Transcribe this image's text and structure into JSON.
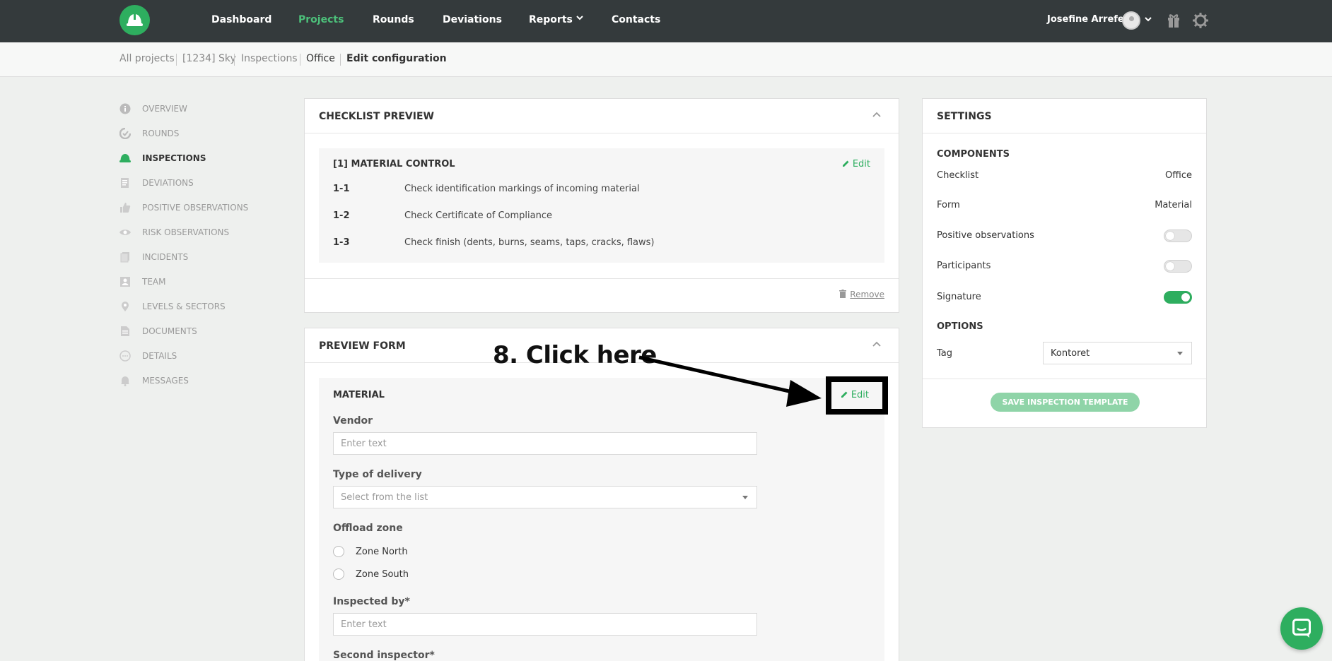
{
  "nav": {
    "items": [
      "Dashboard",
      "Projects",
      "Rounds",
      "Deviations",
      "Reports",
      "Contacts"
    ],
    "active": "Projects",
    "user_name": "Josefine Arrefelt"
  },
  "breadcrumb": {
    "items": [
      "All projects",
      "[1234] Sky",
      "Inspections",
      "Office",
      "Edit configuration"
    ]
  },
  "sidebar": {
    "items": [
      {
        "label": "OVERVIEW",
        "icon": "info-icon"
      },
      {
        "label": "ROUNDS",
        "icon": "rounds-icon"
      },
      {
        "label": "INSPECTIONS",
        "icon": "hardhat-icon",
        "active": true
      },
      {
        "label": "DEVIATIONS",
        "icon": "deviations-icon"
      },
      {
        "label": "POSITIVE OBSERVATIONS",
        "icon": "thumbs-up-icon"
      },
      {
        "label": "RISK OBSERVATIONS",
        "icon": "eye-icon"
      },
      {
        "label": "INCIDENTS",
        "icon": "incidents-icon"
      },
      {
        "label": "TEAM",
        "icon": "team-icon"
      },
      {
        "label": "LEVELS & SECTORS",
        "icon": "location-pin-icon"
      },
      {
        "label": "DOCUMENTS",
        "icon": "document-icon"
      },
      {
        "label": "DETAILS",
        "icon": "details-icon"
      },
      {
        "label": "MESSAGES",
        "icon": "bell-icon"
      }
    ]
  },
  "checklist_preview": {
    "title": "CHECKLIST PREVIEW",
    "section_title": "[1] MATERIAL CONTROL",
    "edit_label": "Edit",
    "rows": [
      {
        "num": "1-1",
        "text": "Check identification markings of incoming material"
      },
      {
        "num": "1-2",
        "text": "Check Certificate of Compliance"
      },
      {
        "num": "1-3",
        "text": "Check finish (dents, burns, seams, taps, cracks, flaws)"
      }
    ],
    "remove_label": "Remove"
  },
  "preview_form": {
    "title": "PREVIEW FORM",
    "section_title": "MATERIAL",
    "edit_label": "Edit",
    "fields": {
      "vendor_label": "Vendor",
      "vendor_placeholder": "Enter text",
      "delivery_label": "Type of delivery",
      "delivery_placeholder": "Select from the list",
      "offload_label": "Offload zone",
      "offload_options": [
        "Zone North",
        "Zone South"
      ],
      "inspected_label": "Inspected by*",
      "inspected_placeholder": "Enter text",
      "second_label": "Second inspector*"
    }
  },
  "settings": {
    "title": "SETTINGS",
    "components_title": "COMPONENTS",
    "checklist_label": "Checklist",
    "checklist_value": "Office",
    "form_label": "Form",
    "form_value": "Material",
    "positive_label": "Positive observations",
    "positive_on": false,
    "participants_label": "Participants",
    "participants_on": false,
    "signature_label": "Signature",
    "signature_on": true,
    "options_title": "OPTIONS",
    "tag_label": "Tag",
    "tag_value": "Kontoret",
    "save_label": "SAVE INSPECTION TEMPLATE"
  },
  "annotation": {
    "text": "8. Click here"
  },
  "colors": {
    "brand_green": "#2eae5f",
    "nav_bg": "#343a3c"
  }
}
